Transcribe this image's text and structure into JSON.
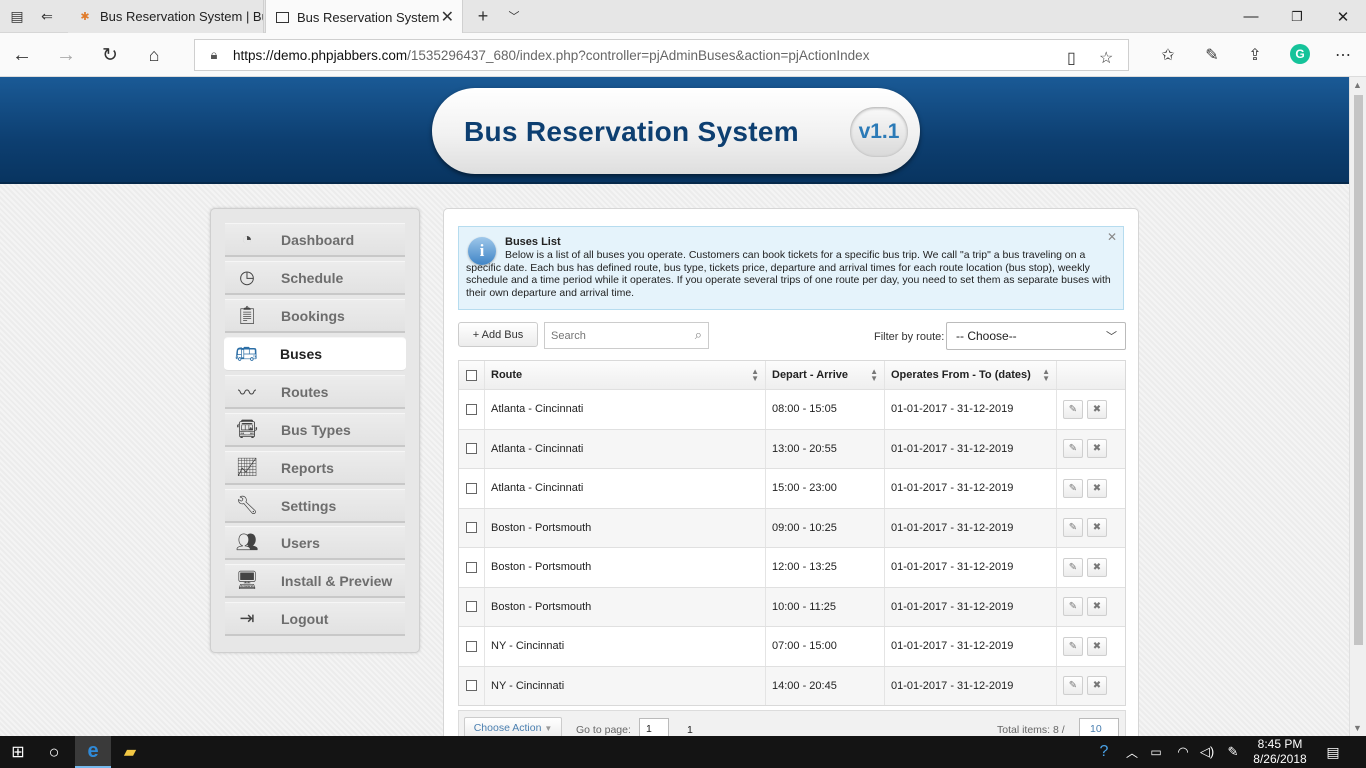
{
  "browser": {
    "tabs": [
      {
        "title": "Bus Reservation System | Bu",
        "active": false
      },
      {
        "title": "Bus Reservation System",
        "active": true
      }
    ],
    "url_host": "https://demo.phpjabbers.com",
    "url_path": "/1535296437_680/index.php?controller=pjAdminBuses&action=pjActionIndex"
  },
  "header": {
    "title": "Bus Reservation System",
    "version": "v1.1"
  },
  "sidebar": {
    "items": [
      {
        "label": "Dashboard",
        "icon": "speedometer-icon",
        "active": false
      },
      {
        "label": "Schedule",
        "icon": "clock-icon",
        "active": false
      },
      {
        "label": "Bookings",
        "icon": "clipboard-icon",
        "active": false
      },
      {
        "label": "Buses",
        "icon": "bus-icon",
        "active": true
      },
      {
        "label": "Routes",
        "icon": "route-icon",
        "active": false
      },
      {
        "label": "Bus Types",
        "icon": "bus-type-icon",
        "active": false
      },
      {
        "label": "Reports",
        "icon": "chart-icon",
        "active": false
      },
      {
        "label": "Settings",
        "icon": "wrench-icon",
        "active": false
      },
      {
        "label": "Users",
        "icon": "users-icon",
        "active": false
      },
      {
        "label": "Install & Preview",
        "icon": "monitor-icon",
        "active": false
      },
      {
        "label": "Logout",
        "icon": "logout-icon",
        "active": false
      }
    ]
  },
  "info": {
    "title": "Buses List",
    "body": "Below is a list of all buses you operate. Customers can book tickets for a specific bus trip. We call \"a trip\" a bus traveling on a specific date. Each bus has defined route, bus type, tickets price, departure and arrival times for each route location (bus stop), weekly schedule and a time period while it operates. If you operate several trips of one route per day, you need to set them as separate buses with their own departure and arrival time."
  },
  "toolbar": {
    "add_label": "+ Add Bus",
    "search_placeholder": "Search",
    "filter_label": "Filter by route:",
    "filter_value": "-- Choose--"
  },
  "table": {
    "columns": [
      "Route",
      "Depart - Arrive",
      "Operates From - To (dates)"
    ],
    "rows": [
      {
        "route": "Atlanta - Cincinnati",
        "time": "08:00 - 15:05",
        "dates": "01-01-2017 - 31-12-2019"
      },
      {
        "route": "Atlanta - Cincinnati",
        "time": "13:00 - 20:55",
        "dates": "01-01-2017 - 31-12-2019"
      },
      {
        "route": "Atlanta - Cincinnati",
        "time": "15:00 - 23:00",
        "dates": "01-01-2017 - 31-12-2019"
      },
      {
        "route": "Boston - Portsmouth",
        "time": "09:00 - 10:25",
        "dates": "01-01-2017 - 31-12-2019"
      },
      {
        "route": "Boston - Portsmouth",
        "time": "12:00 - 13:25",
        "dates": "01-01-2017 - 31-12-2019"
      },
      {
        "route": "Boston - Portsmouth",
        "time": "10:00 - 11:25",
        "dates": "01-01-2017 - 31-12-2019"
      },
      {
        "route": "NY - Cincinnati",
        "time": "07:00 - 15:00",
        "dates": "01-01-2017 - 31-12-2019"
      },
      {
        "route": "NY - Cincinnati",
        "time": "14:00 - 20:45",
        "dates": "01-01-2017 - 31-12-2019"
      }
    ]
  },
  "pager": {
    "choose_action": "Choose Action",
    "goto_label": "Go to page:",
    "page_value": "1",
    "page_count": "1",
    "total_label": "Total items: 8 /",
    "per_page": "10"
  },
  "taskbar": {
    "time": "8:45 PM",
    "date": "8/26/2018"
  }
}
